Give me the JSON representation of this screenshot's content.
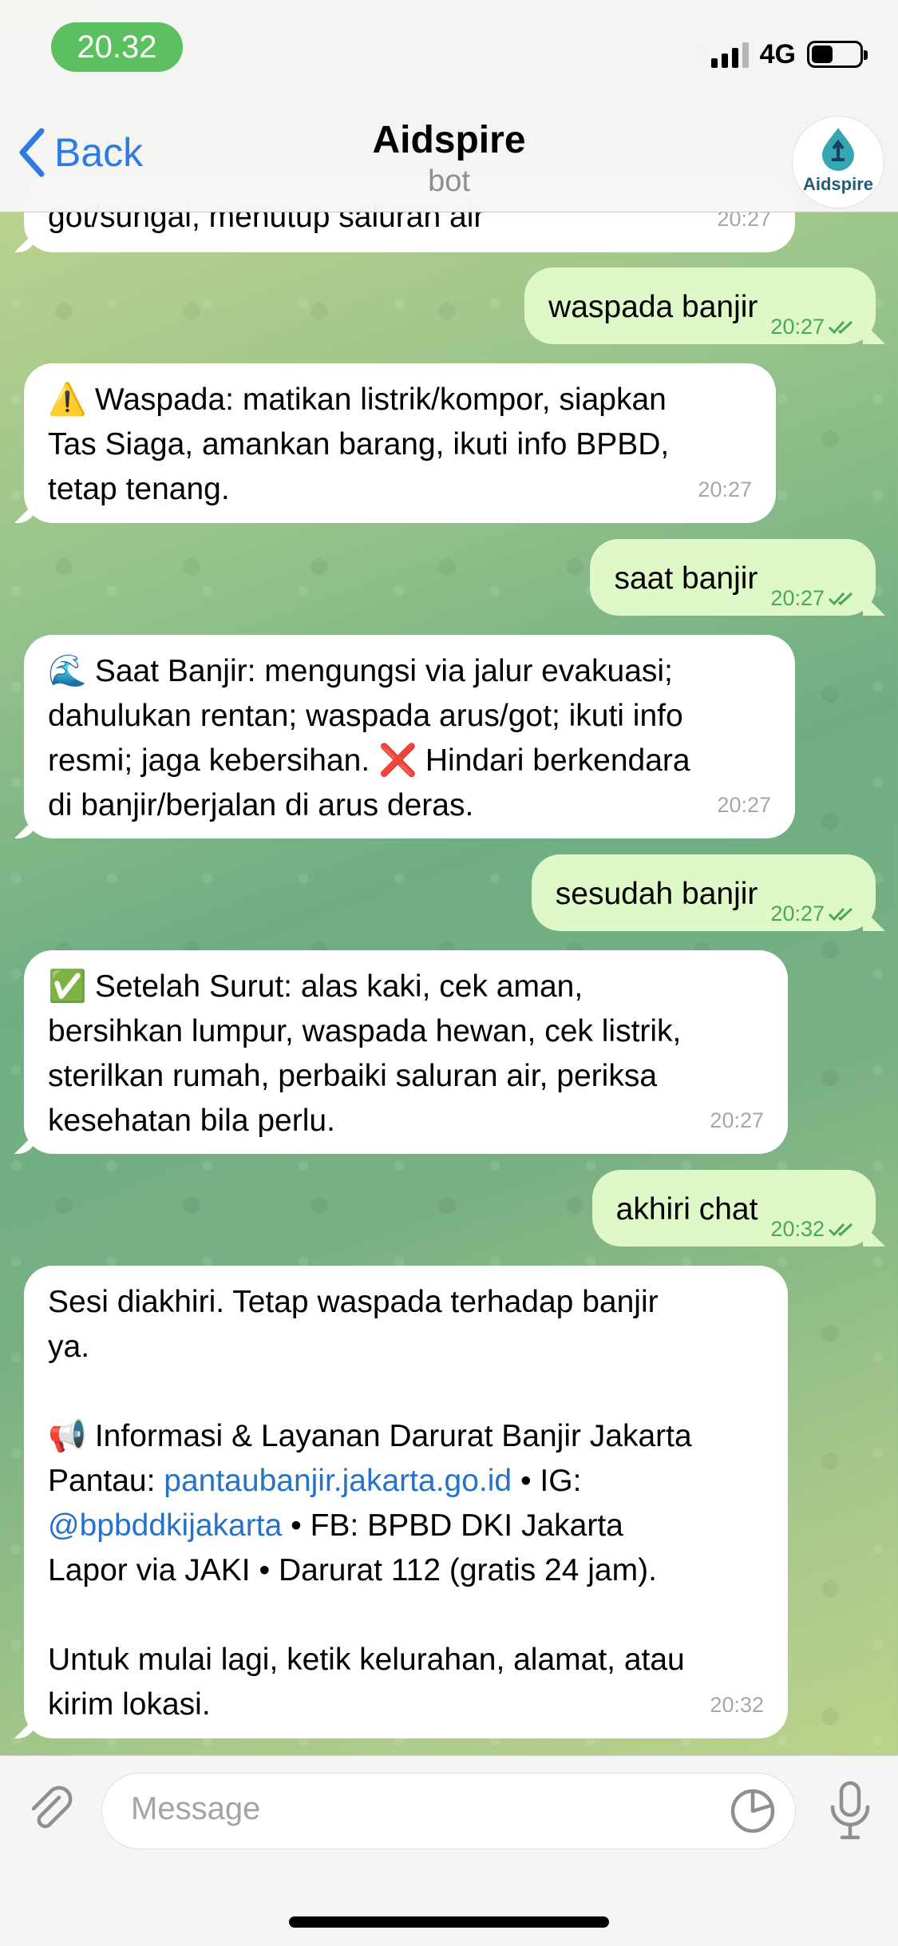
{
  "status_bar": {
    "time": "20.32",
    "network": "4G",
    "battery_level": 0.45
  },
  "nav": {
    "back_label": "Back",
    "title": "Aidspire",
    "subtitle": "bot",
    "avatar_text": "Aidspire"
  },
  "messages": {
    "partial": {
      "text": "got/sungai, menutup saluran air",
      "time": "20:27"
    },
    "out1": {
      "text": "waspada banjir",
      "time": "20:27"
    },
    "in1": {
      "emoji": "⚠️",
      "line1": "Waspada: matikan listrik/kompor, siapkan",
      "line2": "Tas Siaga, amankan barang, ikuti info BPBD,",
      "line3": "tetap tenang.",
      "time": "20:27"
    },
    "out2": {
      "text": "saat banjir",
      "time": "20:27"
    },
    "in2": {
      "emoji": "🌊",
      "line1": "Saat Banjir: mengungsi via jalur evakuasi;",
      "line2": "dahulukan rentan; waspada arus/got; ikuti info",
      "line3a": "resmi; jaga kebersihan.",
      "line3_emoji": "❌",
      "line3b": "Hindari berkendara",
      "line4": "di banjir/berjalan di arus deras.",
      "time": "20:27"
    },
    "out3": {
      "text": "sesudah banjir",
      "time": "20:27"
    },
    "in3": {
      "emoji": "✅",
      "line1": "Setelah Surut: alas kaki, cek aman,",
      "line2": "bersihkan lumpur, waspada hewan, cek listrik,",
      "line3": "sterilkan rumah, perbaiki saluran air, periksa",
      "line4": "kesehatan bila perlu.",
      "time": "20:27"
    },
    "out4": {
      "text": "akhiri chat",
      "time": "20:32"
    },
    "in4": {
      "line1": "Sesi diakhiri. Tetap waspada terhadap banjir",
      "line2": "ya.",
      "emoji": "📢",
      "line3": "Informasi & Layanan Darurat Banjir Jakarta",
      "line4_prefix": "Pantau: ",
      "link1": "pantaubanjir.jakarta.go.id",
      "line4_suffix": " • IG:",
      "link2": "@bpbddkijakarta",
      "line5_suffix": " • FB: BPBD DKI Jakarta",
      "line6": "Lapor via JAKI • Darurat 112 (gratis 24 jam).",
      "line7": "Untuk mulai lagi, ketik kelurahan, alamat, atau",
      "line8": "kirim lokasi.",
      "time": "20:32"
    }
  },
  "composer": {
    "placeholder": "Message"
  },
  "colors": {
    "accent": "#2f7ae5",
    "outgoing_bubble": "#dff8c7",
    "status_pill": "#5cbf60",
    "link": "#2672c9"
  }
}
